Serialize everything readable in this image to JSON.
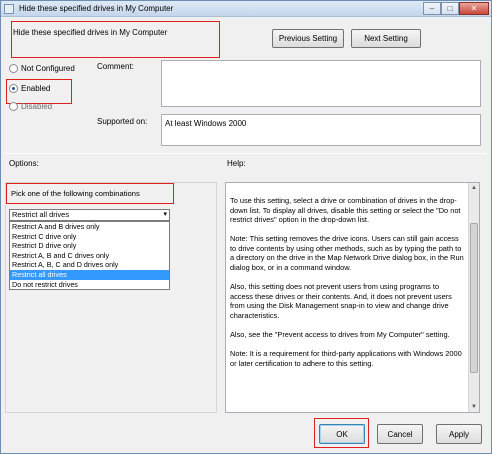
{
  "window": {
    "title": "Hide these specified drives in My Computer",
    "controls": {
      "minimize": "–",
      "maximize": "□",
      "close": "✕"
    }
  },
  "policy_title": "Hide these specified drives in My Computer",
  "nav": {
    "previous": "Previous Setting",
    "next": "Next Setting"
  },
  "state": {
    "not_configured": "Not Configured",
    "enabled": "Enabled",
    "disabled": "Disabled",
    "selected": "Enabled"
  },
  "comment_label": "Comment:",
  "comment_value": "",
  "supported_label": "Supported on:",
  "supported_value": "At least Windows 2000",
  "options_label": "Options:",
  "help_label": "Help:",
  "options": {
    "prompt": "Pick one of the following combinations",
    "selected": "Restrict all drives",
    "items": [
      "Restrict A and B drives only",
      "Restrict C drive only",
      "Restrict D drive only",
      "Restrict A, B and C drives only",
      "Restrict A, B, C and D drives only",
      "Restrict all drives",
      "Do not restrict drives"
    ]
  },
  "help": {
    "p1": "To use this setting, select a drive or combination of drives in the drop-down list. To display all drives, disable this setting or select the \"Do not restrict drives\" option in the drop-down list.",
    "p2": "Note: This setting removes the drive icons. Users can still gain access to drive contents by using other methods, such as by typing the path to a directory on the drive in the Map Network Drive dialog box, in the Run dialog box, or in a command window.",
    "p3": "Also, this setting does not prevent users from using programs to access these drives or their contents. And, it does not prevent users from using the Disk Management snap-in to view and change drive characteristics.",
    "p4": "Also, see the \"Prevent access to drives from My Computer\" setting.",
    "p5": "Note: It is a requirement for third-party applications with Windows 2000 or later certification to adhere to this setting."
  },
  "buttons": {
    "ok": "OK",
    "cancel": "Cancel",
    "apply": "Apply"
  }
}
